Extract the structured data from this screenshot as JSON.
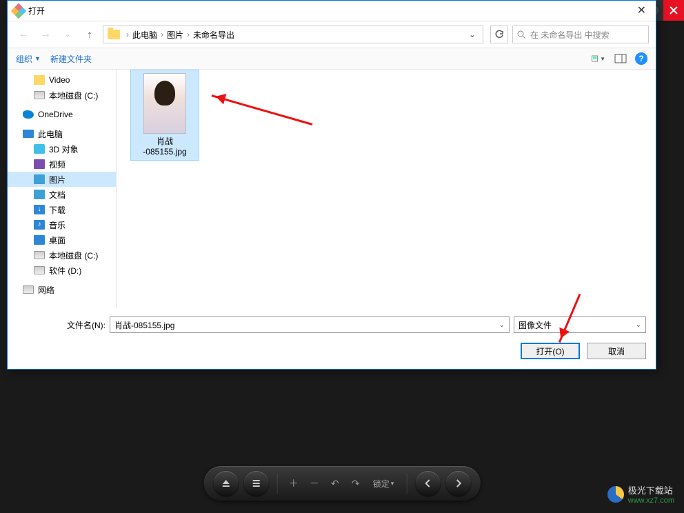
{
  "dialog": {
    "title": "打开",
    "breadcrumb": {
      "root": "此电脑",
      "folder1": "图片",
      "folder2": "未命名导出"
    },
    "search_placeholder": "在 未命名导出 中搜索",
    "toolbar": {
      "organize": "组织",
      "new_folder": "新建文件夹"
    },
    "tree": {
      "video": "Video",
      "local_c": "本地磁盘 (C:)",
      "onedrive": "OneDrive",
      "this_pc": "此电脑",
      "obj3d": "3D 对象",
      "videos": "视频",
      "pictures": "图片",
      "documents": "文档",
      "downloads": "下载",
      "music": "音乐",
      "desktop": "桌面",
      "local_c2": "本地磁盘 (C:)",
      "soft_d": "软件 (D:)",
      "network": "网络"
    },
    "file": {
      "name_line1": "肖战",
      "name_line2": "-085155.jpg"
    },
    "footer": {
      "fn_label": "文件名(N):",
      "fn_value": "肖战-085155.jpg",
      "type_value": "图像文件",
      "open": "打开(O)",
      "cancel": "取消"
    }
  },
  "toolbar": {
    "lock": "锁定"
  },
  "watermark": {
    "line1": "极光下载站",
    "line2": "www.xz7.com"
  }
}
